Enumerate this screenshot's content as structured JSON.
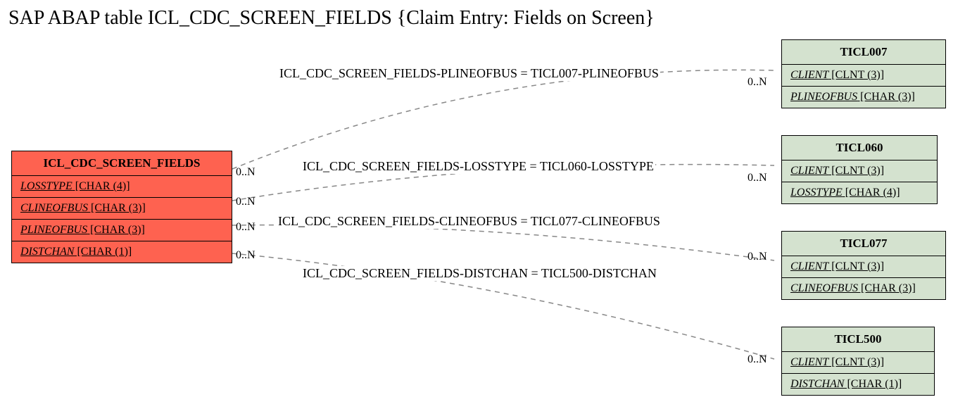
{
  "title": "SAP ABAP table ICL_CDC_SCREEN_FIELDS {Claim Entry: Fields on Screen}",
  "source": {
    "name": "ICL_CDC_SCREEN_FIELDS",
    "rows": [
      {
        "field": "LOSSTYPE",
        "type": " [CHAR (4)]"
      },
      {
        "field": "CLINEOFBUS",
        "type": " [CHAR (3)]"
      },
      {
        "field": "PLINEOFBUS",
        "type": " [CHAR (3)]"
      },
      {
        "field": "DISTCHAN",
        "type": " [CHAR (1)]"
      }
    ]
  },
  "targets": [
    {
      "name": "TICL007",
      "rows": [
        {
          "field": "CLIENT",
          "type": " [CLNT (3)]"
        },
        {
          "field": "PLINEOFBUS",
          "type": " [CHAR (3)]"
        }
      ]
    },
    {
      "name": "TICL060",
      "rows": [
        {
          "field": "CLIENT",
          "type": " [CLNT (3)]"
        },
        {
          "field": "LOSSTYPE",
          "type": " [CHAR (4)]"
        }
      ]
    },
    {
      "name": "TICL077",
      "rows": [
        {
          "field": "CLIENT",
          "type": " [CLNT (3)]"
        },
        {
          "field": "CLINEOFBUS",
          "type": " [CHAR (3)]"
        }
      ]
    },
    {
      "name": "TICL500",
      "rows": [
        {
          "field": "CLIENT",
          "type": " [CLNT (3)]"
        },
        {
          "field": "DISTCHAN",
          "type": " [CHAR (1)]"
        }
      ]
    }
  ],
  "relations": {
    "r1": "ICL_CDC_SCREEN_FIELDS-PLINEOFBUS = TICL007-PLINEOFBUS",
    "r2": "ICL_CDC_SCREEN_FIELDS-LOSSTYPE = TICL060-LOSSTYPE",
    "r3": "ICL_CDC_SCREEN_FIELDS-CLINEOFBUS = TICL077-CLINEOFBUS",
    "r4": "ICL_CDC_SCREEN_FIELDS-DISTCHAN = TICL500-DISTCHAN"
  },
  "card": "0..N"
}
